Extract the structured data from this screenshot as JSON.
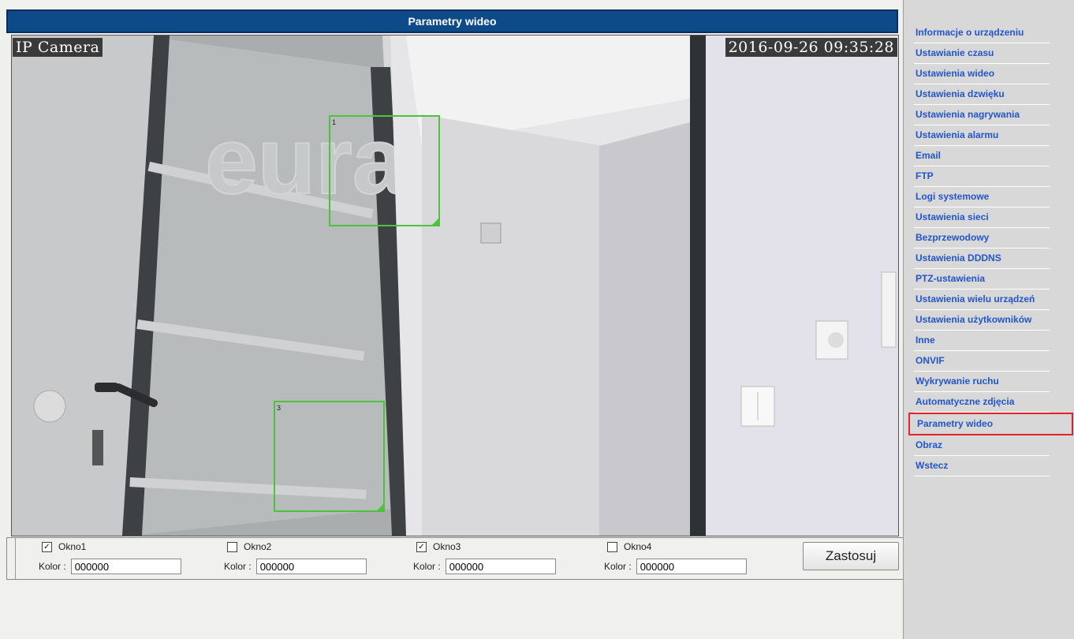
{
  "panel": {
    "title": "Parametry wideo"
  },
  "video": {
    "osd_name": "IP Camera",
    "osd_time": "2016-09-26 09:35:28",
    "zones": [
      {
        "label": "1",
        "visible": true
      },
      {
        "label": "3",
        "visible": true
      }
    ]
  },
  "controls": {
    "windows": [
      {
        "label": "Okno1",
        "checked": true,
        "color_label": "Kolor :",
        "color_value": "000000"
      },
      {
        "label": "Okno2",
        "checked": false,
        "color_label": "Kolor :",
        "color_value": "000000"
      },
      {
        "label": "Okno3",
        "checked": true,
        "color_label": "Kolor :",
        "color_value": "000000"
      },
      {
        "label": "Okno4",
        "checked": false,
        "color_label": "Kolor :",
        "color_value": "000000"
      }
    ],
    "apply_label": "Zastosuj"
  },
  "sidebar": {
    "items": [
      {
        "label": "Informacje o urządzeniu"
      },
      {
        "label": "Ustawianie czasu"
      },
      {
        "label": "Ustawienia wideo"
      },
      {
        "label": "Ustawienia dzwięku"
      },
      {
        "label": "Ustawienia nagrywania"
      },
      {
        "label": "Ustawienia alarmu"
      },
      {
        "label": "Email"
      },
      {
        "label": "FTP"
      },
      {
        "label": "Logi systemowe"
      },
      {
        "label": "Ustawienia sieci"
      },
      {
        "label": "Bezprzewodowy"
      },
      {
        "label": "Ustawienia DDDNS"
      },
      {
        "label": "PTZ-ustawienia"
      },
      {
        "label": "Ustawienia wielu urządzeń"
      },
      {
        "label": "Ustawienia użytkowników"
      },
      {
        "label": "Inne"
      },
      {
        "label": "ONVIF"
      },
      {
        "label": "Wykrywanie ruchu"
      },
      {
        "label": "Automatyczne zdjęcia"
      },
      {
        "label": "Parametry wideo",
        "active": true
      },
      {
        "label": "Obraz"
      },
      {
        "label": "Wstecz"
      }
    ]
  },
  "colors": {
    "title_bar": "#0d4a8a",
    "link": "#2255cc",
    "active_outline": "#e2232a",
    "zone_outline": "#4fc23d"
  }
}
